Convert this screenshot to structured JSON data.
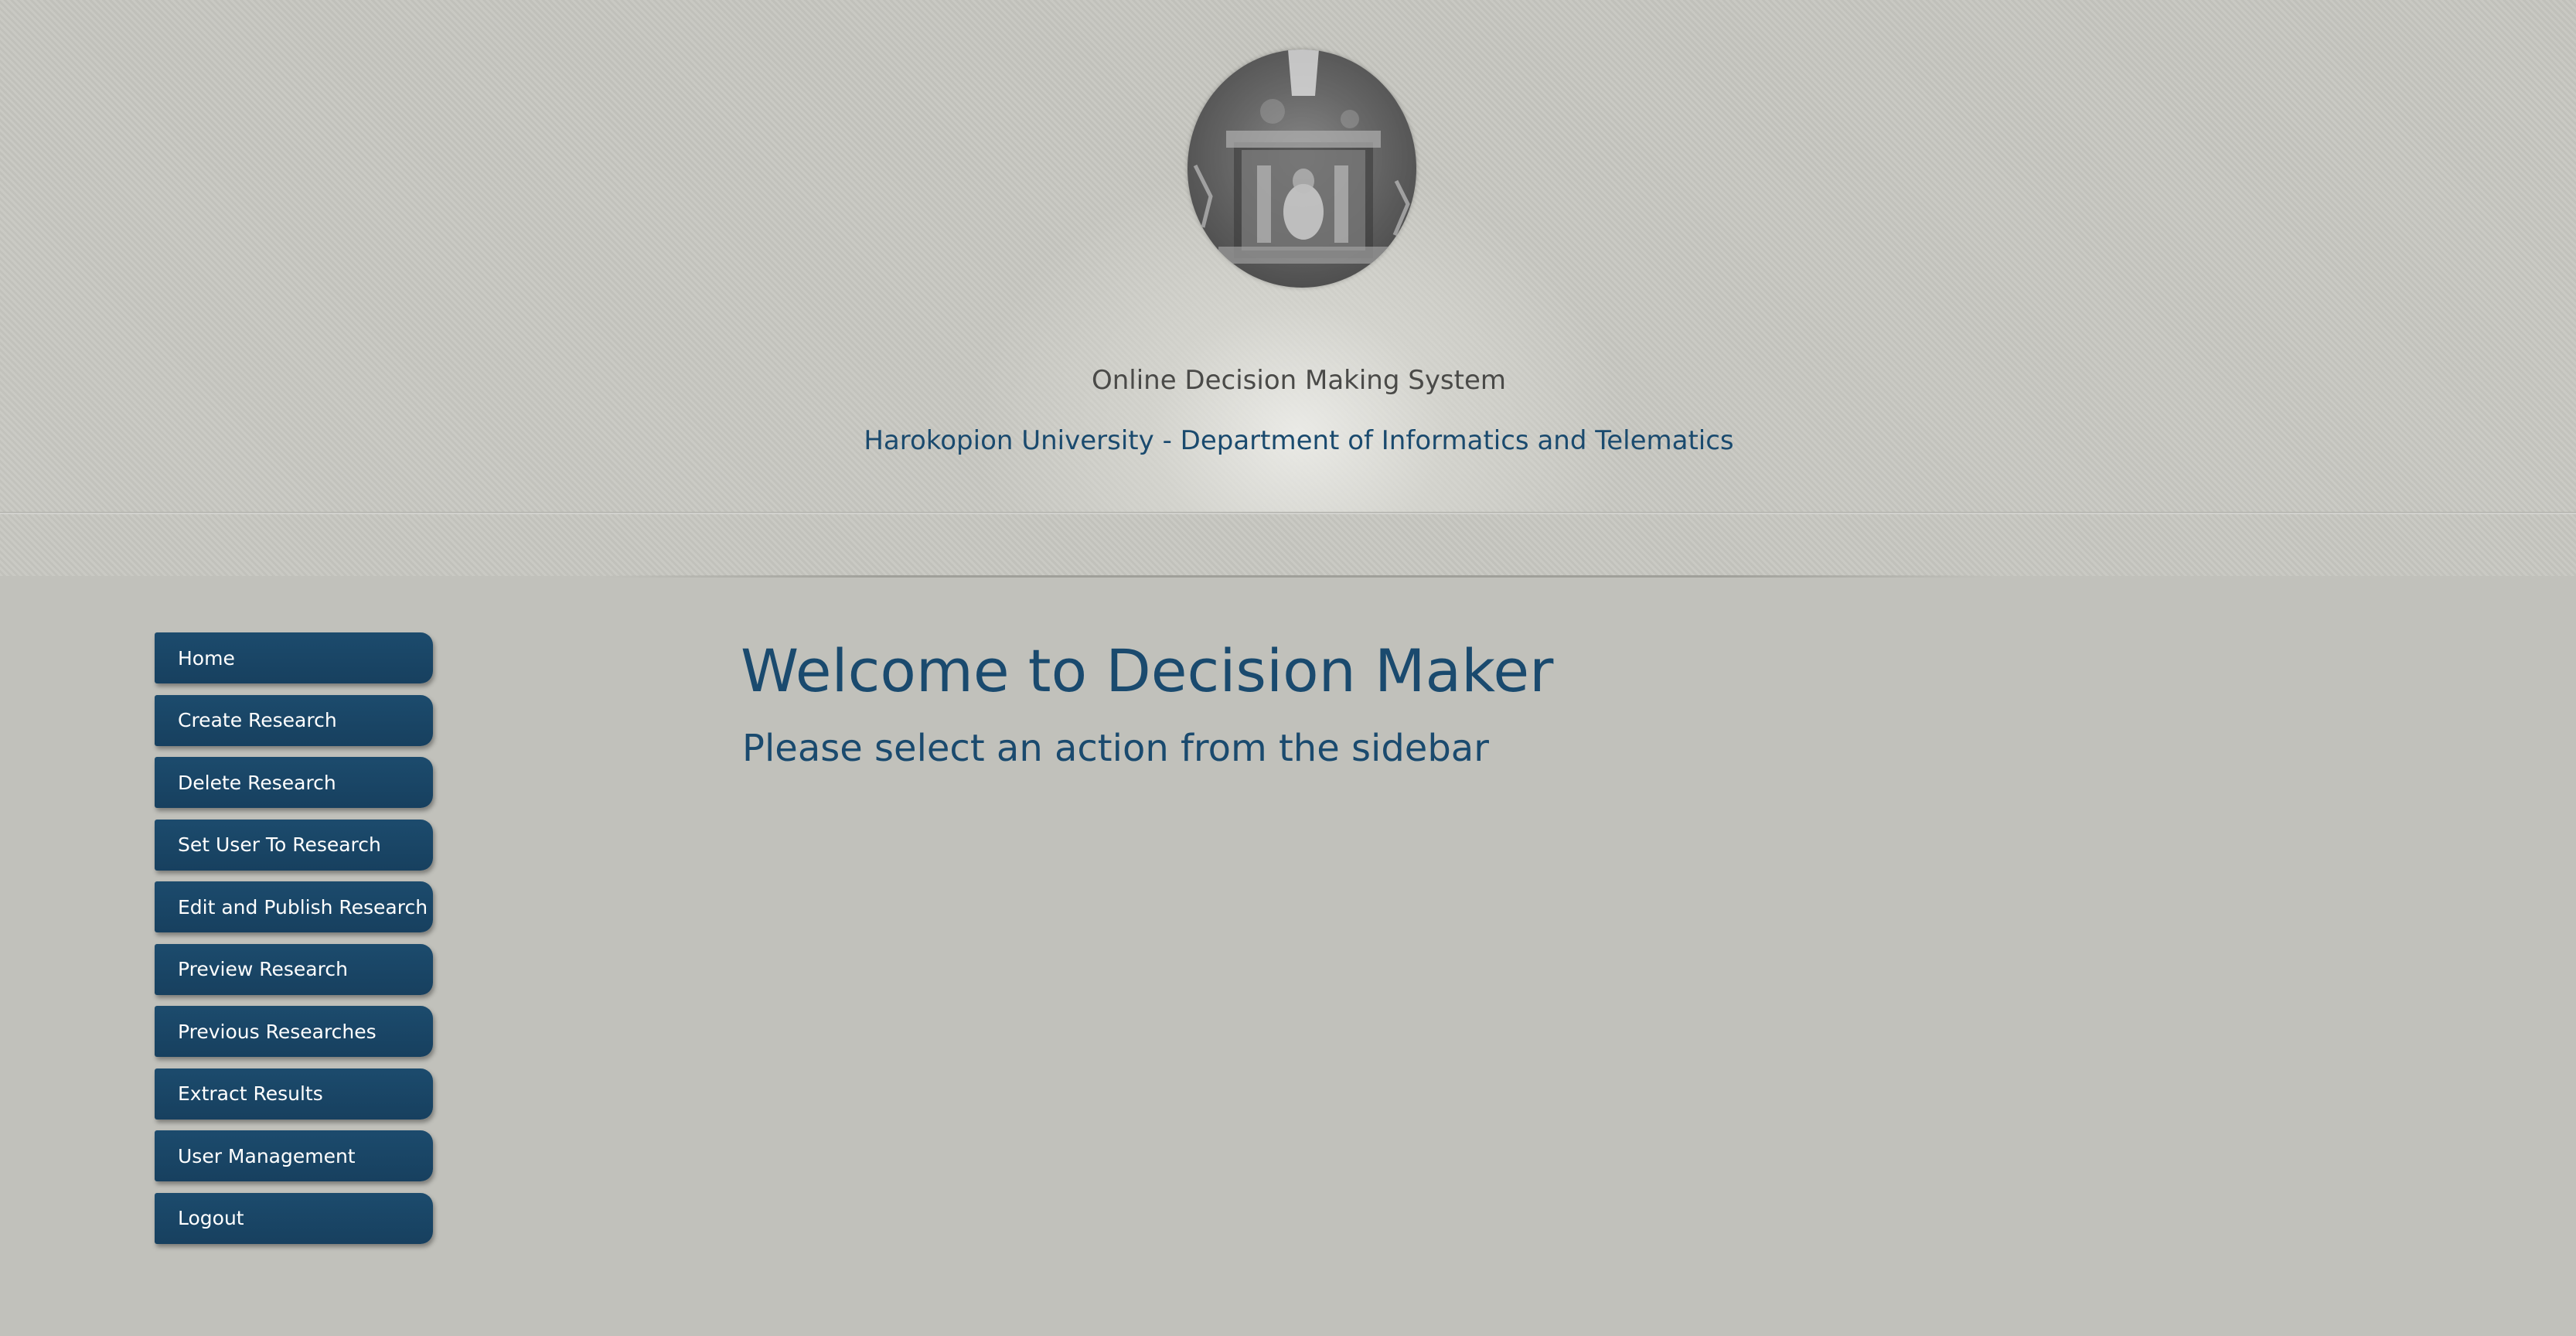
{
  "header": {
    "subtitle": "Online Decision Making System",
    "institution": "Harokopion University - Department of Informatics and Telematics"
  },
  "sidebar": {
    "items": [
      {
        "label": "Home"
      },
      {
        "label": "Create Research"
      },
      {
        "label": "Delete Research"
      },
      {
        "label": "Set User To Research"
      },
      {
        "label": "Edit and Publish Research"
      },
      {
        "label": "Preview Research"
      },
      {
        "label": "Previous Researches"
      },
      {
        "label": "Extract Results"
      },
      {
        "label": "User Management"
      },
      {
        "label": "Logout"
      }
    ]
  },
  "main": {
    "title": "Welcome to Decision Maker",
    "hint": "Please select an action from the sidebar"
  },
  "colors": {
    "accent": "#17405f",
    "heading": "#1a4a6e",
    "background": "#c1c1bb"
  }
}
